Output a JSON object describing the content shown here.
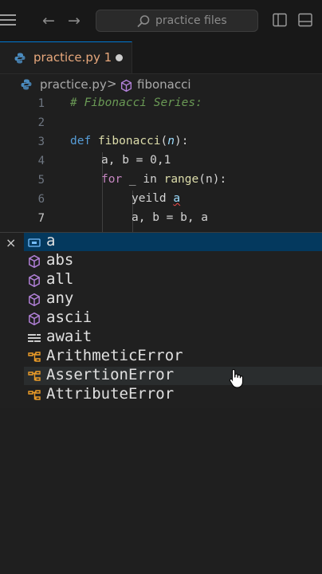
{
  "titlebar": {
    "back_glyph": "←",
    "forward_glyph": "→",
    "search_placeholder": "practice files"
  },
  "tab": {
    "label": "practice.py",
    "problems_count": "1"
  },
  "breadcrumb": {
    "file": "practice.py",
    "separator": ">",
    "symbol": "fibonacci"
  },
  "editor": {
    "lines": [
      {
        "n": "1",
        "comment": "# Fibonacci Series:"
      },
      {
        "n": "2"
      },
      {
        "n": "3",
        "kw": "def",
        "fn": "fibonacci",
        "open": "(",
        "param": "n",
        "close": "):"
      },
      {
        "n": "4",
        "text": "a, b = 0,1"
      },
      {
        "n": "5",
        "kw": "for",
        "text": " _ in ",
        "fn": "range",
        "rest": "(n):"
      },
      {
        "n": "6",
        "text": "yeild ",
        "err": "a"
      },
      {
        "n": "7",
        "text": "a, b = b, a"
      }
    ]
  },
  "suggest": {
    "close_glyph": "×",
    "items": [
      {
        "label": "a",
        "icon": "variable-icon"
      },
      {
        "label": "abs",
        "icon": "method-cube-icon"
      },
      {
        "label": "all",
        "icon": "method-cube-icon"
      },
      {
        "label": "any",
        "icon": "method-cube-icon"
      },
      {
        "label": "ascii",
        "icon": "method-cube-icon"
      },
      {
        "label": "await",
        "icon": "keyword-icon"
      },
      {
        "label": "ArithmeticError",
        "icon": "class-icon"
      },
      {
        "label": "AssertionError",
        "icon": "class-icon"
      },
      {
        "label": "AttributeError",
        "icon": "class-icon"
      }
    ]
  },
  "colors": {
    "accent": "#0078d4",
    "modified_tab": "#e8a87c",
    "method_icon": "#b180d7",
    "class_icon": "#ee9d28"
  }
}
